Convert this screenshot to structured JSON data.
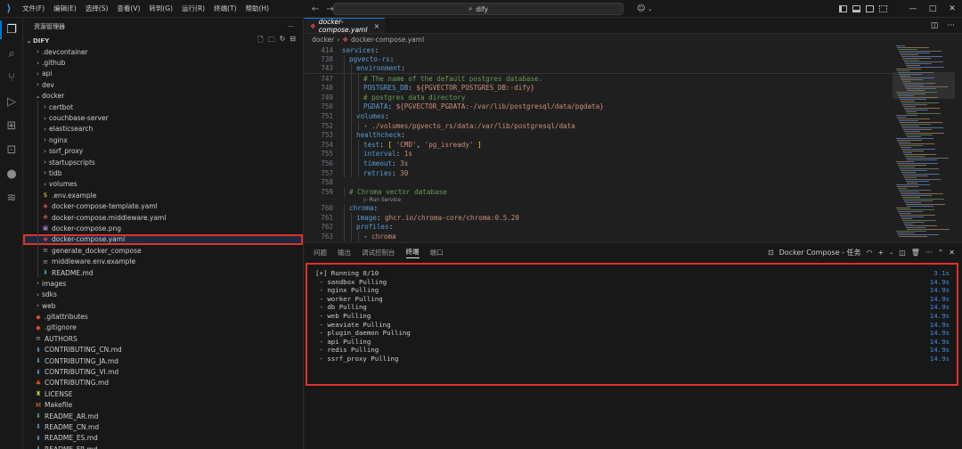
{
  "titlebar": {
    "menu": [
      "文件(F)",
      "编辑(E)",
      "选择(S)",
      "查看(V)",
      "转到(G)",
      "运行(R)",
      "终端(T)",
      "帮助(H)"
    ],
    "search_text": "dify",
    "search_icon": "search-icon",
    "account_icon": "copilot-icon"
  },
  "activitybar": {
    "items": [
      "explorer-icon",
      "search-icon",
      "source-control-icon",
      "run-debug-icon",
      "extensions-icon",
      "remote-explorer-icon",
      "github-icon",
      "docker-icon"
    ]
  },
  "sidebar": {
    "title": "资源管理器",
    "more": "···",
    "project": "DIFY",
    "tree": [
      {
        "label": ".devcontainer",
        "depth": 0,
        "kind": "folder",
        "open": false
      },
      {
        "label": ".github",
        "depth": 0,
        "kind": "folder",
        "open": false
      },
      {
        "label": "api",
        "depth": 0,
        "kind": "folder",
        "open": false
      },
      {
        "label": "dev",
        "depth": 0,
        "kind": "folder",
        "open": false
      },
      {
        "label": "docker",
        "depth": 0,
        "kind": "folder",
        "open": true
      },
      {
        "label": "certbot",
        "depth": 1,
        "kind": "folder",
        "open": false
      },
      {
        "label": "couchbase-server",
        "depth": 1,
        "kind": "folder",
        "open": false
      },
      {
        "label": "elasticsearch",
        "depth": 1,
        "kind": "folder",
        "open": false
      },
      {
        "label": "nginx",
        "depth": 1,
        "kind": "folder",
        "open": false
      },
      {
        "label": "ssrf_proxy",
        "depth": 1,
        "kind": "folder",
        "open": false
      },
      {
        "label": "startupscripts",
        "depth": 1,
        "kind": "folder",
        "open": false
      },
      {
        "label": "tidb",
        "depth": 1,
        "kind": "folder",
        "open": false
      },
      {
        "label": "volumes",
        "depth": 1,
        "kind": "folder",
        "open": false
      },
      {
        "label": ".env.example",
        "depth": 1,
        "kind": "env"
      },
      {
        "label": "docker-compose-template.yaml",
        "depth": 1,
        "kind": "yaml"
      },
      {
        "label": "docker-compose.middleware.yaml",
        "depth": 1,
        "kind": "yaml"
      },
      {
        "label": "docker-compose.png",
        "depth": 1,
        "kind": "png"
      },
      {
        "label": "docker-compose.yaml",
        "depth": 1,
        "kind": "yaml",
        "selected": true
      },
      {
        "label": "generate_docker_compose",
        "depth": 1,
        "kind": "file"
      },
      {
        "label": "middleware.env.example",
        "depth": 1,
        "kind": "file"
      },
      {
        "label": "README.md",
        "depth": 1,
        "kind": "md"
      },
      {
        "label": "images",
        "depth": 0,
        "kind": "folder",
        "open": false
      },
      {
        "label": "sdks",
        "depth": 0,
        "kind": "folder",
        "open": false
      },
      {
        "label": "web",
        "depth": 0,
        "kind": "folder",
        "open": false
      },
      {
        "label": ".gitattributes",
        "depth": 0,
        "kind": "git"
      },
      {
        "label": ".gitignore",
        "depth": 0,
        "kind": "git"
      },
      {
        "label": "AUTHORS",
        "depth": 0,
        "kind": "file"
      },
      {
        "label": "CONTRIBUTING_CN.md",
        "depth": 0,
        "kind": "md"
      },
      {
        "label": "CONTRIBUTING_JA.md",
        "depth": 0,
        "kind": "md"
      },
      {
        "label": "CONTRIBUTING_VI.md",
        "depth": 0,
        "kind": "md"
      },
      {
        "label": "CONTRIBUTING.md",
        "depth": 0,
        "kind": "contrib"
      },
      {
        "label": "LICENSE",
        "depth": 0,
        "kind": "license"
      },
      {
        "label": "Makefile",
        "depth": 0,
        "kind": "make"
      },
      {
        "label": "README_AR.md",
        "depth": 0,
        "kind": "md"
      },
      {
        "label": "README_CN.md",
        "depth": 0,
        "kind": "md"
      },
      {
        "label": "README_ES.md",
        "depth": 0,
        "kind": "md"
      },
      {
        "label": "README_FR.md",
        "depth": 0,
        "kind": "md"
      }
    ]
  },
  "editor": {
    "tab_label": "docker-compose.yaml",
    "tab_close": "×",
    "breadcrumb": [
      "docker",
      "docker-compose.yaml"
    ],
    "codelens": "▷ Run Service",
    "lines": [
      {
        "n": "414",
        "sticky": true,
        "indent": 0,
        "parts": [
          [
            "k",
            "services"
          ],
          [
            "p",
            ":"
          ]
        ]
      },
      {
        "n": "738",
        "sticky": true,
        "indent": 1,
        "parts": [
          [
            "k",
            "pgvecto-rs"
          ],
          [
            "p",
            ":"
          ]
        ]
      },
      {
        "n": "743",
        "sticky": true,
        "indent": 2,
        "parts": [
          [
            "k",
            "environment"
          ],
          [
            "p",
            ":"
          ]
        ]
      },
      {
        "n": "747",
        "indent": 3,
        "parts": [
          [
            "c",
            "# The name of the default postgres database."
          ]
        ]
      },
      {
        "n": "748",
        "indent": 3,
        "parts": [
          [
            "k",
            "POSTGRES_DB"
          ],
          [
            "p",
            ": "
          ],
          [
            "s",
            "${PGVECTOR_POSTGRES_DB:-dify}"
          ]
        ]
      },
      {
        "n": "749",
        "indent": 3,
        "parts": [
          [
            "c",
            "# postgres data directory"
          ]
        ]
      },
      {
        "n": "750",
        "indent": 3,
        "parts": [
          [
            "k",
            "PGDATA"
          ],
          [
            "p",
            ": "
          ],
          [
            "s",
            "${PGVECTOR_PGDATA:-/var/lib/postgresql/data/pgdata}"
          ]
        ]
      },
      {
        "n": "751",
        "indent": 2,
        "parts": [
          [
            "k",
            "volumes"
          ],
          [
            "p",
            ":"
          ]
        ]
      },
      {
        "n": "752",
        "indent": 3,
        "parts": [
          [
            "p",
            "- "
          ],
          [
            "s",
            "./volumes/pgvecto_rs/data:/var/lib/postgresql/data"
          ]
        ]
      },
      {
        "n": "753",
        "indent": 2,
        "parts": [
          [
            "k",
            "healthcheck"
          ],
          [
            "p",
            ":"
          ]
        ]
      },
      {
        "n": "754",
        "indent": 3,
        "parts": [
          [
            "k",
            "test"
          ],
          [
            "p",
            ": "
          ],
          [
            "b",
            "["
          ],
          [
            "p",
            " "
          ],
          [
            "s",
            "'CMD'"
          ],
          [
            "p",
            ", "
          ],
          [
            "s",
            "'pg_isready'"
          ],
          [
            "p",
            " "
          ],
          [
            "b",
            "]"
          ]
        ]
      },
      {
        "n": "755",
        "indent": 3,
        "parts": [
          [
            "k",
            "interval"
          ],
          [
            "p",
            ": "
          ],
          [
            "s",
            "1s"
          ]
        ]
      },
      {
        "n": "756",
        "indent": 3,
        "parts": [
          [
            "k",
            "timeout"
          ],
          [
            "p",
            ": "
          ],
          [
            "s",
            "3s"
          ]
        ]
      },
      {
        "n": "757",
        "indent": 3,
        "parts": [
          [
            "k",
            "retries"
          ],
          [
            "p",
            ": "
          ],
          [
            "s",
            "30"
          ]
        ]
      },
      {
        "n": "758",
        "indent": 0,
        "parts": []
      },
      {
        "n": "759",
        "indent": 1,
        "parts": [
          [
            "c",
            "# Chroma vector database"
          ]
        ],
        "lens": true
      },
      {
        "n": "760",
        "indent": 1,
        "parts": [
          [
            "k",
            "chroma"
          ],
          [
            "p",
            ":"
          ]
        ]
      },
      {
        "n": "761",
        "indent": 2,
        "parts": [
          [
            "k",
            "image"
          ],
          [
            "p",
            ": "
          ],
          [
            "s",
            "ghcr.io/chroma-core/chroma:0.5.20"
          ]
        ]
      },
      {
        "n": "762",
        "indent": 2,
        "parts": [
          [
            "k",
            "profiles"
          ],
          [
            "p",
            ":"
          ]
        ]
      },
      {
        "n": "763",
        "indent": 3,
        "parts": [
          [
            "p",
            "- "
          ],
          [
            "s",
            "chroma"
          ]
        ]
      }
    ]
  },
  "panel": {
    "tabs": [
      "问题",
      "输出",
      "调试控制台",
      "终端",
      "端口"
    ],
    "active_tab": "终端",
    "terminal_title": "Docker Compose - 任务",
    "terminal_lines": [
      {
        "text": "[+] Running 0/10",
        "time": "3.1s"
      },
      {
        "text": " - sandbox Pulling",
        "time": "14.9s"
      },
      {
        "text": " - nginx Pulling",
        "time": "14.9s"
      },
      {
        "text": " - worker Pulling",
        "time": "14.9s"
      },
      {
        "text": " - db Pulling",
        "time": "14.9s"
      },
      {
        "text": " - web Pulling",
        "time": "14.9s"
      },
      {
        "text": " - weaviate Pulling",
        "time": "14.9s"
      },
      {
        "text": " - plugin_daemon Pulling",
        "time": "14.9s"
      },
      {
        "text": " - api Pulling",
        "time": "14.9s"
      },
      {
        "text": " - redis Pulling",
        "time": "14.9s"
      },
      {
        "text": " - ssrf_proxy Pulling",
        "time": "14.9s"
      }
    ]
  }
}
